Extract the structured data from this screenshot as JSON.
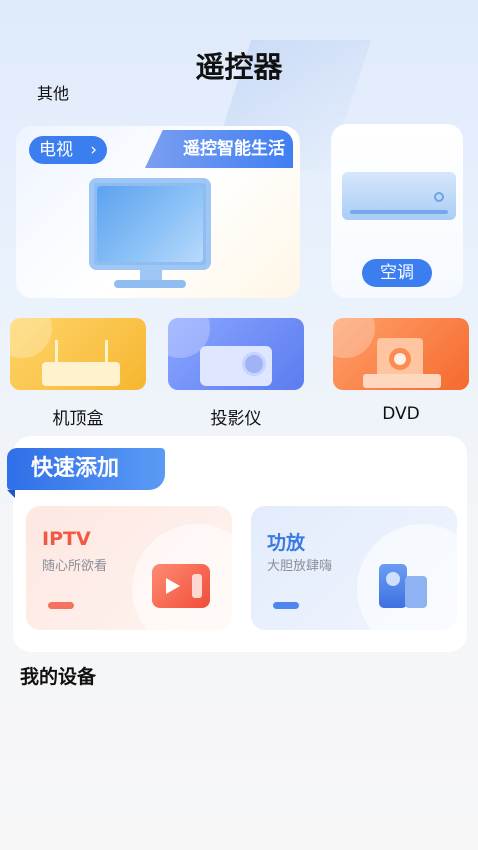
{
  "header": {
    "title": "遥控器",
    "other_label": "其他"
  },
  "featured": {
    "tv": {
      "label": "电视",
      "arrow": "›",
      "banner": "遥控智能生活"
    },
    "ac": {
      "label": "空调"
    }
  },
  "devices": [
    {
      "label": "机顶盒",
      "color": "#f6b630"
    },
    {
      "label": "投影仪",
      "color": "#5c7cf0"
    },
    {
      "label": "DVD",
      "color": "#f56a2d"
    }
  ],
  "quick_add": {
    "title": "快速添加",
    "items": [
      {
        "title": "IPTV",
        "subtitle": "随心所欲看",
        "accent": "#ef5a44"
      },
      {
        "title": "功放",
        "subtitle": "大胆放肆嗨",
        "accent": "#3b78e3"
      }
    ]
  },
  "my_devices": {
    "title": "我的设备"
  }
}
